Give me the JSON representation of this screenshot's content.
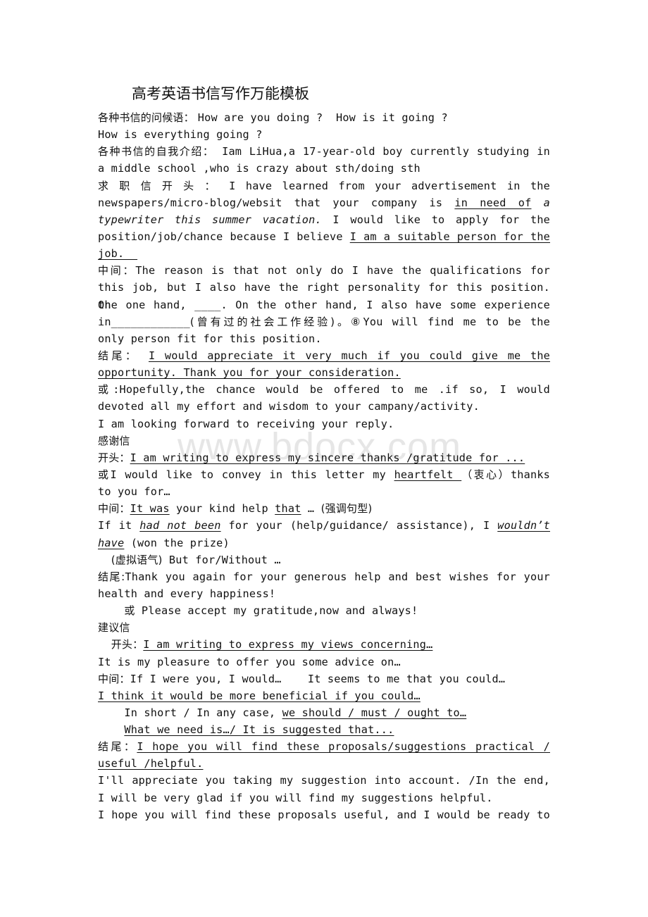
{
  "watermark": "www.bdocx.com",
  "title": "高考英语书信写作万能模板",
  "lines": [
    {
      "segs": [
        {
          "t": "各种书信的问候语： ",
          "cn": true
        },
        {
          "t": "How are you doing ?  How is it going ?"
        }
      ]
    },
    {
      "segs": [
        {
          "t": "How is everything going ?"
        }
      ]
    },
    {
      "segs": [
        {
          "t": "各种书信的自我介绍：",
          "cn": true
        },
        {
          "t": " Iam LiHua,a 17-year-old boy currently studying in"
        }
      ],
      "just": true
    },
    {
      "segs": [
        {
          "t": "a middle school ,who is crazy about sth/doing sth"
        }
      ]
    },
    {
      "segs": [
        {
          "t": "求 职 信  开 头 ：",
          "cn": true
        },
        {
          "t": " I have learned from your advertisement in the"
        }
      ],
      "just": true
    },
    {
      "segs": [
        {
          "t": "newspapers/micro-blog/websit that your company is "
        },
        {
          "t": "in need of",
          "u": true
        },
        {
          "t": " "
        },
        {
          "t": "a",
          "i": true
        }
      ],
      "just": true
    },
    {
      "segs": [
        {
          "t": "typewriter this summer vacation.",
          "i": true
        },
        {
          "t": " I would like to apply for the"
        }
      ],
      "just": true
    },
    {
      "segs": [
        {
          "t": "position/job/chance because I believe "
        },
        {
          "t": "I am a suitable person for the",
          "u": true
        }
      ],
      "just": true
    },
    {
      "segs": [
        {
          "t": "job.  ",
          "u": true
        }
      ]
    },
    {
      "segs": [
        {
          "t": "中间：",
          "cn": true
        },
        {
          "t": "The reason is that not only do I have the qualifications for"
        }
      ],
      "just": true
    },
    {
      "segs": [
        {
          "t": "this job, but I also have the right personality for this position. On"
        }
      ],
      "just": true
    },
    {
      "segs": [
        {
          "t": "the one hand, ____. On the other hand, I also have some experience"
        }
      ],
      "just": true
    },
    {
      "segs": [
        {
          "t": "in____________"
        },
        {
          "t": "(曾有过的社会工作经验)。",
          "cn": true
        },
        {
          "t": "⑧You will find me to be the"
        }
      ],
      "just": true
    },
    {
      "segs": [
        {
          "t": "only person fit for this position."
        }
      ]
    },
    {
      "segs": [
        {
          "t": "结尾：",
          "cn": true
        },
        {
          "t": " "
        },
        {
          "t": " I would appreciate it very much if you could give me the",
          "u": true
        }
      ],
      "just": true
    },
    {
      "segs": [
        {
          "t": "opportunity. Thank you for your consideration.",
          "u": true
        }
      ]
    },
    {
      "segs": [
        {
          "t": "或",
          "cn": true
        },
        {
          "t": ":Hopefully,the chance would be offered to me .if so, I  would"
        }
      ],
      "just": true
    },
    {
      "segs": [
        {
          "t": "devoted all my effort and wisdom to your campany/activity."
        }
      ]
    },
    {
      "segs": [
        {
          "t": "I am looking forward to receiving your reply."
        }
      ]
    },
    {
      "segs": [
        {
          "t": "感谢信",
          "cn": true
        }
      ]
    },
    {
      "segs": [
        {
          "t": "开头：",
          "cn": true
        },
        {
          "t": "I am writing to express my sincere thanks /gratitude for ...",
          "u": true
        }
      ]
    },
    {
      "segs": [
        {
          "t": "或",
          "cn": true
        },
        {
          "t": "I would like to convey in this letter my "
        },
        {
          "t": "heartfelt ",
          "u": true
        },
        {
          "t": "  "
        },
        {
          "t": "（衷心）",
          "cn": true
        },
        {
          "t": "thanks"
        }
      ],
      "just": true
    },
    {
      "segs": [
        {
          "t": "to you for…"
        }
      ]
    },
    {
      "segs": [
        {
          "t": "中间：",
          "cn": true
        },
        {
          "t": "It was",
          "u": true
        },
        {
          "t": " your kind help "
        },
        {
          "t": "that",
          "u": true
        },
        {
          "t": " … "
        },
        {
          "t": "(强调句型)",
          "cn": true
        }
      ]
    },
    {
      "segs": [
        {
          "t": "If it "
        },
        {
          "t": "had not been",
          "u": true,
          "i": true
        },
        {
          "t": " for your (help/guidance/ assistance), I "
        },
        {
          "t": "wouldn’t",
          "u": true,
          "i": true
        }
      ],
      "just": true
    },
    {
      "segs": [
        {
          "t": "have",
          "u": true,
          "i": true
        },
        {
          "t": " (won the prize)"
        }
      ]
    },
    {
      "segs": [
        {
          "t": "  "
        },
        {
          "t": "(虚拟语气)",
          "cn": true
        },
        {
          "t": " But for/Without …"
        }
      ]
    },
    {
      "segs": [
        {
          "t": " "
        },
        {
          "t": "结尾:",
          "cn": true
        },
        {
          "t": "Thank you again for your generous help and best wishes for your"
        }
      ],
      "just": true
    },
    {
      "segs": [
        {
          "t": "health and every happiness!"
        }
      ]
    },
    {
      "segs": [
        {
          "t": "    "
        },
        {
          "t": "或",
          "cn": true
        },
        {
          "t": " Please accept my gratitude,now and always!"
        }
      ]
    },
    {
      "segs": [
        {
          "t": "建议信",
          "cn": true
        }
      ]
    },
    {
      "segs": [
        {
          "t": "  "
        },
        {
          "t": "开头：",
          "cn": true
        },
        {
          "t": "I am writing to express my views concerning…",
          "u": true
        }
      ]
    },
    {
      "segs": [
        {
          "t": "It is my pleasure to offer you some advice on…"
        }
      ]
    },
    {
      "segs": [
        {
          "t": "中间：",
          "cn": true
        },
        {
          "t": "If I were you, I would…    It seems to me that you could…"
        }
      ]
    },
    {
      "segs": [
        {
          "t": "I think it would be more beneficial if you could…",
          "u": true
        }
      ]
    },
    {
      "segs": [
        {
          "t": "    In short / In any case, "
        },
        {
          "t": "we should / must / ought to…",
          "u": true
        }
      ]
    },
    {
      "segs": [
        {
          "t": "    "
        },
        {
          "t": "What we need is…/ It is suggested that...",
          "u": true
        }
      ]
    },
    {
      "segs": [
        {
          "t": "结尾：",
          "cn": true
        },
        {
          "t": "I hope you will find these proposals/suggestions  practical /",
          "u": true
        }
      ],
      "just": true
    },
    {
      "segs": [
        {
          "t": "useful /helpful.",
          "u": true
        }
      ]
    },
    {
      "segs": [
        {
          "t": "I'll appreciate you taking my suggestion into account.   /In the end,"
        }
      ],
      "just": true
    },
    {
      "segs": [
        {
          "t": "I will be very glad if you will find my suggestions helpful."
        }
      ]
    },
    {
      "segs": [
        {
          "t": "I hope you will find these proposals useful, and I would be ready to"
        }
      ],
      "just": true
    }
  ]
}
